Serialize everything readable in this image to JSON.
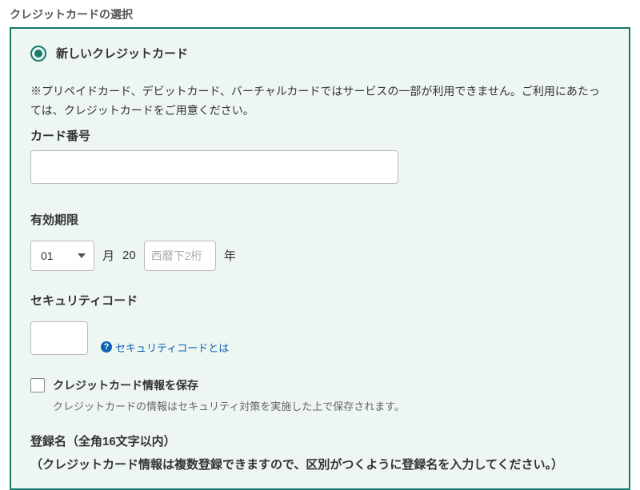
{
  "section_title": "クレジットカードの選択",
  "radio": {
    "new_card_label": "新しいクレジットカード"
  },
  "notice": "※プリペイドカード、デビットカード、バーチャルカードではサービスの一部が利用できません。ご利用にあたっては、クレジットカードをご用意ください。",
  "card_number": {
    "label": "カード番号"
  },
  "expiry": {
    "label": "有効期限",
    "month_selected": "01",
    "month_unit": "月",
    "year_prefix": "20",
    "year_placeholder": "西暦下2桁",
    "year_unit": "年"
  },
  "security": {
    "label": "セキュリティコード",
    "help_text": "セキュリティコードとは"
  },
  "save_card": {
    "label": "クレジットカード情報を保存",
    "desc": "クレジットカードの情報はセキュリティ対策を実施した上で保存されます。"
  },
  "registration": {
    "label": "登録名（全角16文字以内）",
    "sub": "（クレジットカード情報は複数登録できますので、区別がつくように登録名を入力してください。）"
  }
}
